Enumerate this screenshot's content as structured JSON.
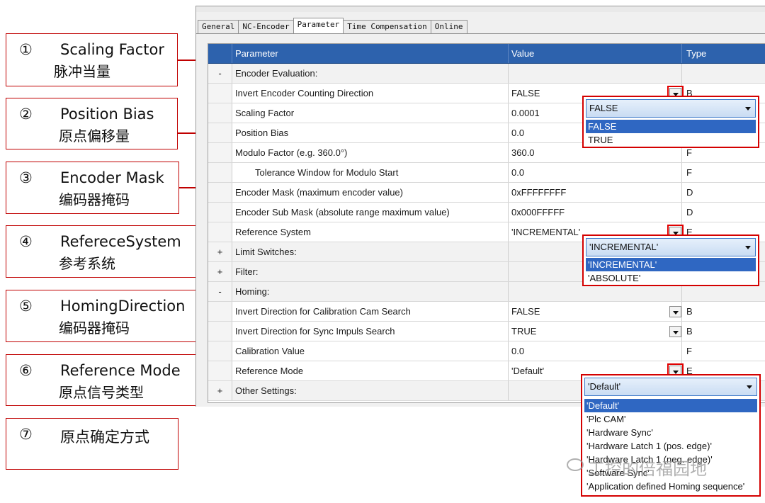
{
  "annotations": [
    {
      "num": "①",
      "en": "Scaling Factor",
      "zh": "脉冲当量"
    },
    {
      "num": "②",
      "en": "Position Bias",
      "zh": "原点偏移量"
    },
    {
      "num": "③",
      "en": "Encoder Mask",
      "zh": "编码器掩码"
    },
    {
      "num": "④",
      "en": "RefereceSystem",
      "zh": "参考系统"
    },
    {
      "num": "⑤",
      "en": "HomingDirection",
      "zh": "编码器掩码"
    },
    {
      "num": "⑥",
      "en": "Reference Mode",
      "zh": "原点信号类型"
    },
    {
      "num": "⑦",
      "en": "",
      "zh": "原点确定方式"
    }
  ],
  "tabs": [
    "General",
    "NC-Encoder",
    "Parameter",
    "Time Compensation",
    "Online"
  ],
  "active_tab": "Parameter",
  "table": {
    "headers": [
      "Parameter",
      "Value",
      "Type"
    ],
    "rows": [
      {
        "toggle": "-",
        "name": "Encoder Evaluation:",
        "value": "",
        "type": ""
      },
      {
        "toggle": "",
        "name": "Invert Encoder Counting Direction",
        "value": "FALSE",
        "type": "B"
      },
      {
        "toggle": "",
        "name": "Scaling Factor",
        "value": "0.0001",
        "type": ""
      },
      {
        "toggle": "",
        "name": "Position Bias",
        "value": "0.0",
        "type": ""
      },
      {
        "toggle": "",
        "name": "Modulo Factor (e.g. 360.0°)",
        "value": "360.0",
        "type": "F"
      },
      {
        "toggle": "",
        "name": "Tolerance Window for Modulo Start",
        "value": "0.0",
        "type": "F"
      },
      {
        "toggle": "",
        "name": "Encoder Mask (maximum encoder value)",
        "value": "0xFFFFFFFF",
        "type": "D"
      },
      {
        "toggle": "",
        "name": "Encoder Sub Mask (absolute range maximum value)",
        "value": "0x000FFFFF",
        "type": "D"
      },
      {
        "toggle": "",
        "name": "Reference System",
        "value": "'INCREMENTAL'",
        "type": "E"
      },
      {
        "toggle": "+",
        "name": "Limit Switches:",
        "value": "",
        "type": ""
      },
      {
        "toggle": "+",
        "name": "Filter:",
        "value": "",
        "type": ""
      },
      {
        "toggle": "-",
        "name": "Homing:",
        "value": "",
        "type": ""
      },
      {
        "toggle": "",
        "name": "Invert Direction for Calibration Cam Search",
        "value": "FALSE",
        "type": "B"
      },
      {
        "toggle": "",
        "name": "Invert Direction for Sync Impuls Search",
        "value": "TRUE",
        "type": "B"
      },
      {
        "toggle": "",
        "name": "Calibration Value",
        "value": "0.0",
        "type": "F"
      },
      {
        "toggle": "",
        "name": "Reference Mode",
        "value": "'Default'",
        "type": "E"
      },
      {
        "toggle": "+",
        "name": "Other Settings:",
        "value": "",
        "type": ""
      }
    ]
  },
  "popups": {
    "bool": {
      "current": "FALSE",
      "options": [
        "FALSE",
        "TRUE"
      ],
      "selected": "FALSE"
    },
    "refsys": {
      "current": "'INCREMENTAL'",
      "options": [
        "'INCREMENTAL'",
        "'ABSOLUTE'"
      ],
      "selected": "'INCREMENTAL'"
    },
    "refmode": {
      "current": "'Default'",
      "options": [
        "'Default'",
        "'Plc CAM'",
        "'Hardware Sync'",
        "'Hardware Latch 1 (pos. edge)'",
        "'Hardware Latch 1 (neg. edge)'",
        "'Software Sync'",
        "'Application defined Homing sequence'"
      ],
      "selected": "'Default'"
    }
  },
  "watermark": "工控的倍福园地",
  "colors": {
    "annotation_red": "#c00000",
    "header_blue": "#2d62ad",
    "selection_blue": "#2f67c2"
  }
}
